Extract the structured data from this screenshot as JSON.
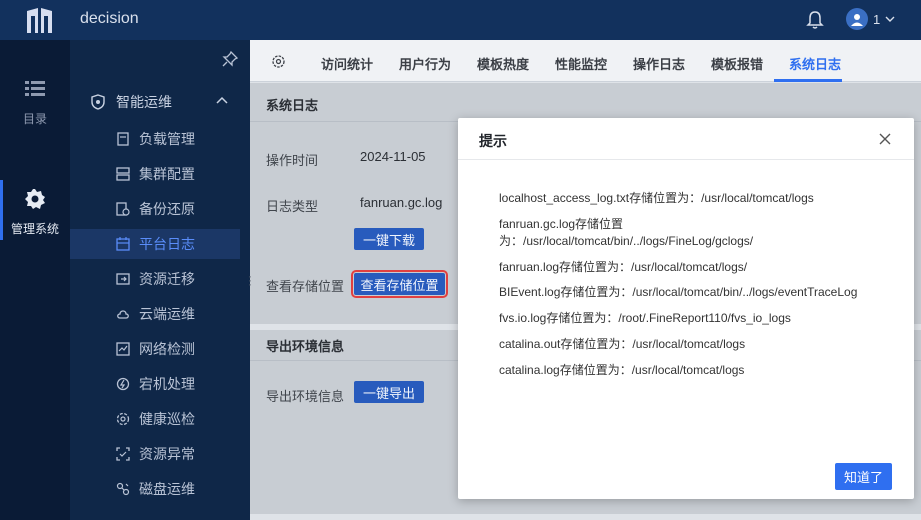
{
  "app": {
    "title": "decision",
    "user_name": "1"
  },
  "left_nav": {
    "items": [
      {
        "label": "目录"
      },
      {
        "label": "管理系统"
      }
    ]
  },
  "sub_nav": {
    "group_label": "智能运维",
    "items": [
      {
        "label": "负载管理"
      },
      {
        "label": "集群配置"
      },
      {
        "label": "备份还原"
      },
      {
        "label": "平台日志"
      },
      {
        "label": "资源迁移"
      },
      {
        "label": "云端运维"
      },
      {
        "label": "网络检测"
      },
      {
        "label": "宕机处理"
      },
      {
        "label": "健康巡检"
      },
      {
        "label": "资源异常"
      },
      {
        "label": "磁盘运维"
      }
    ]
  },
  "tabs": [
    {
      "label": "访问统计"
    },
    {
      "label": "用户行为"
    },
    {
      "label": "模板热度"
    },
    {
      "label": "性能监控"
    },
    {
      "label": "操作日志"
    },
    {
      "label": "模板报错"
    },
    {
      "label": "系统日志"
    }
  ],
  "system_log": {
    "section_title": "系统日志",
    "op_time_label": "操作时间",
    "op_time_value": "2024-11-05",
    "log_type_label": "日志类型",
    "log_type_value": "fanruan.gc.log",
    "download_button": "一键下载",
    "storage_label": "查看存储位置",
    "storage_button": "查看存储位置"
  },
  "export_env": {
    "section_title": "导出环境信息",
    "label": "导出环境信息",
    "button": "一键导出"
  },
  "modal": {
    "title": "提示",
    "lines": [
      "localhost_access_log.txt存储位置为：/usr/local/tomcat/logs",
      "fanruan.gc.log存储位置",
      "为：/usr/local/tomcat/bin/../logs/FineLog/gclogs/",
      "fanruan.log存储位置为：/usr/local/tomcat/logs/",
      "BIEvent.log存储位置为：/usr/local/tomcat/bin/../logs/eventTraceLog",
      "fvs.io.log存储位置为：/root/.FineReport110/fvs_io_logs",
      "catalina.out存储位置为：/usr/local/tomcat/logs",
      "catalina.log存储位置为：/usr/local/tomcat/logs"
    ],
    "ok_button": "知道了"
  },
  "colors": {
    "topbar": "#12315d",
    "accent": "#2f6ff0",
    "highlight": "#e04040"
  }
}
